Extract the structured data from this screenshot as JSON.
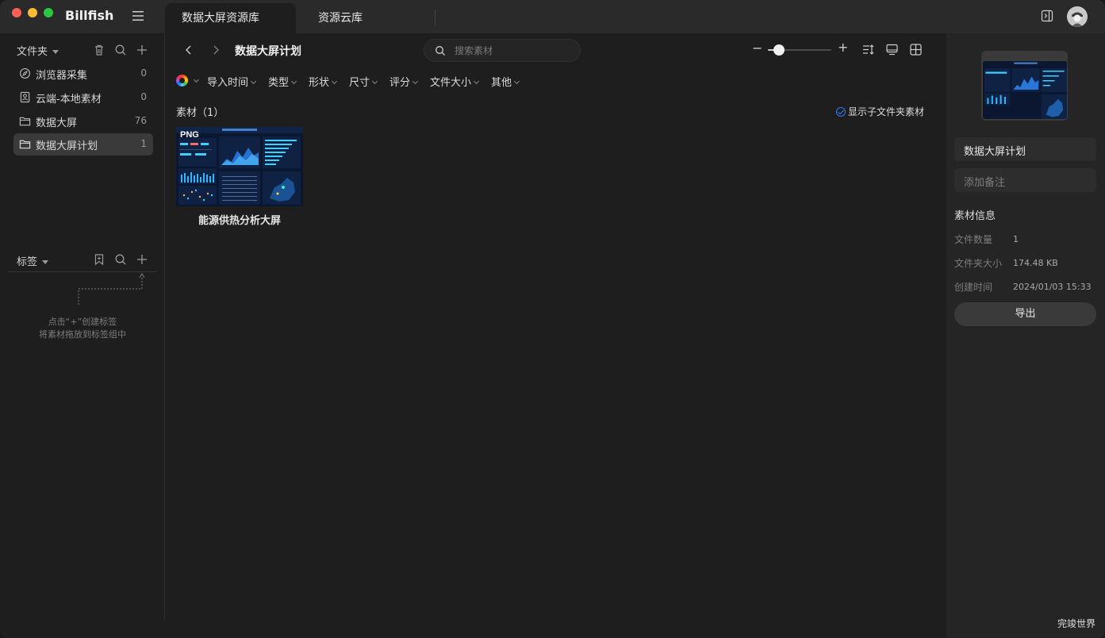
{
  "app": {
    "title": "Billfish"
  },
  "tabs": [
    {
      "label": "数据大屏资源库",
      "active": true
    },
    {
      "label": "资源云库",
      "active": false
    }
  ],
  "sidebar": {
    "folders_title": "文件夹",
    "folders": [
      {
        "label": "浏览器采集",
        "count": "0",
        "icon": "compass-icon"
      },
      {
        "label": "云端-本地素材",
        "count": "0",
        "icon": "cloud-local-icon"
      },
      {
        "label": "数据大屏",
        "count": "76",
        "icon": "folder-icon"
      },
      {
        "label": "数据大屏计划",
        "count": "1",
        "icon": "folder-icon",
        "selected": true
      }
    ],
    "tags_title": "标签",
    "tags_hint_line1": "点击“+”创建标签",
    "tags_hint_line2": "将素材拖放到标签组中"
  },
  "main": {
    "breadcrumb_title": "数据大屏计划",
    "search_placeholder": "搜索素材",
    "filters": [
      "导入时间",
      "类型",
      "形状",
      "尺寸",
      "评分",
      "文件大小",
      "其他"
    ],
    "material_count_label": "素材（1）",
    "show_subfolder_label": "显示子文件夹素材",
    "zoom_level": 0.1,
    "assets": [
      {
        "name": "能源供热分析大屏",
        "format": "PNG"
      }
    ]
  },
  "detail": {
    "title": "数据大屏计划",
    "note_placeholder": "添加备注",
    "section_title": "素材信息",
    "info": [
      {
        "label": "文件数量",
        "value": "1"
      },
      {
        "label": "文件夹大小",
        "value": "174.48 KB"
      },
      {
        "label": "创建时间",
        "value": "2024/01/03 15:33"
      }
    ],
    "export_label": "导出"
  },
  "watermark": "完竣世界",
  "colors": {
    "accent": "#2f7cf6",
    "bg": "#1e1e1f",
    "panel": "#252526"
  }
}
